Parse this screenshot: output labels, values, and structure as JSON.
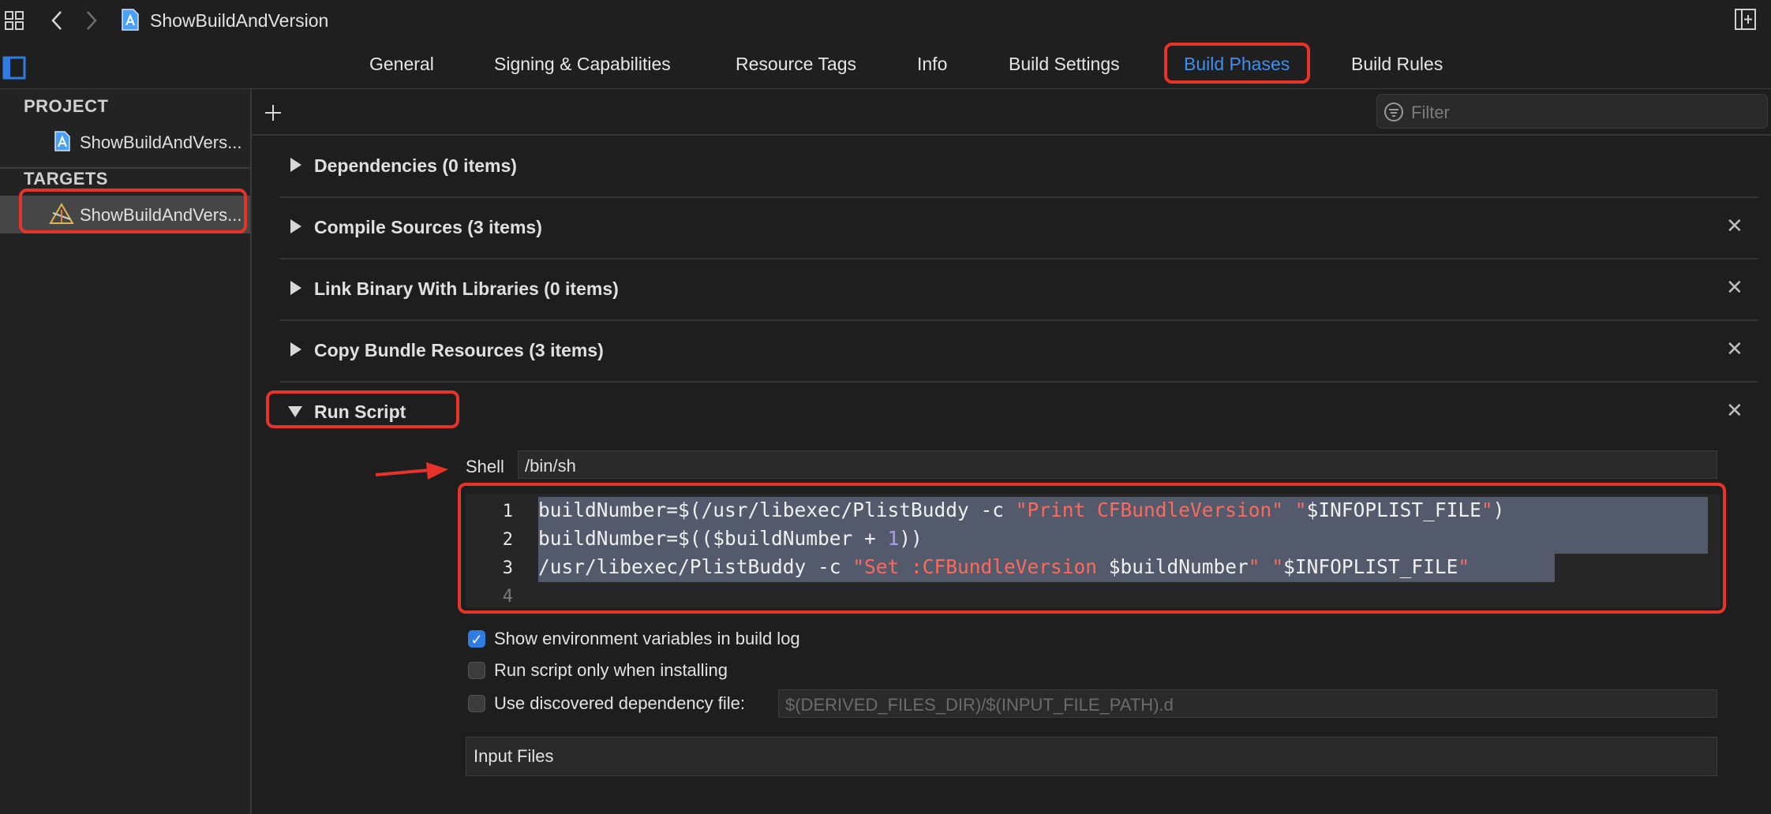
{
  "window": {
    "title": "ShowBuildAndVersion",
    "icons": [
      "grid-icon",
      "back-chevron-icon",
      "forward-chevron-icon",
      "project-file-icon",
      "add-editor-icon",
      "sidebar-toggle-icon"
    ]
  },
  "tabs": [
    {
      "label": "General",
      "selected": false
    },
    {
      "label": "Signing & Capabilities",
      "selected": false
    },
    {
      "label": "Resource Tags",
      "selected": false
    },
    {
      "label": "Info",
      "selected": false
    },
    {
      "label": "Build Settings",
      "selected": false
    },
    {
      "label": "Build Phases",
      "selected": true
    },
    {
      "label": "Build Rules",
      "selected": false
    }
  ],
  "sidebar": {
    "project_header": "PROJECT",
    "project_item": "ShowBuildAndVers...",
    "targets_header": "TARGETS",
    "target_item": "ShowBuildAndVers..."
  },
  "toolbar": {
    "add_label": "+",
    "filter_placeholder": "Filter"
  },
  "phases": [
    {
      "label": "Dependencies (0 items)",
      "expanded": false,
      "closable": false
    },
    {
      "label": "Compile Sources (3 items)",
      "expanded": false,
      "closable": true
    },
    {
      "label": "Link Binary With Libraries (0 items)",
      "expanded": false,
      "closable": true
    },
    {
      "label": "Copy Bundle Resources (3 items)",
      "expanded": false,
      "closable": true
    },
    {
      "label": "Run Script",
      "expanded": true,
      "closable": true
    }
  ],
  "run_script": {
    "shell_label": "Shell",
    "shell_value": "/bin/sh",
    "line_numbers": [
      "1",
      "2",
      "3",
      "4"
    ],
    "code": {
      "l1_a": "buildNumber=$(/usr/libexec/PlistBuddy -c ",
      "l1_s1": "\"Print CFBundleVersion\"",
      "l1_b": " ",
      "l1_s2": "\"",
      "l1_c": "$INFOPLIST_FILE",
      "l1_s3": "\"",
      "l1_d": ")",
      "l2_a": "buildNumber=$(($buildNumber + ",
      "l2_n": "1",
      "l2_b": "))",
      "l3_a": "/usr/libexec/PlistBuddy -c ",
      "l3_s1": "\"Set :CFBundleVersion ",
      "l3_b": "$buildNumber",
      "l3_s2": "\"",
      "l3_c": " ",
      "l3_s3": "\"",
      "l3_d": "$INFOPLIST_FILE",
      "l3_s4": "\""
    },
    "options": [
      {
        "label": "Show environment variables in build log",
        "checked": true
      },
      {
        "label": "Run script only when installing",
        "checked": false
      },
      {
        "label": "Use discovered dependency file:",
        "checked": false
      }
    ],
    "dependency_file_placeholder": "$(DERIVED_FILES_DIR)/$(INPUT_FILE_PATH).d",
    "input_files_label": "Input Files"
  },
  "colors": {
    "accent": "#3d8ff0",
    "annotation_red": "#e8332a",
    "string": "#fc6a5d",
    "number": "#a79df9",
    "selection": "#525a6b"
  }
}
